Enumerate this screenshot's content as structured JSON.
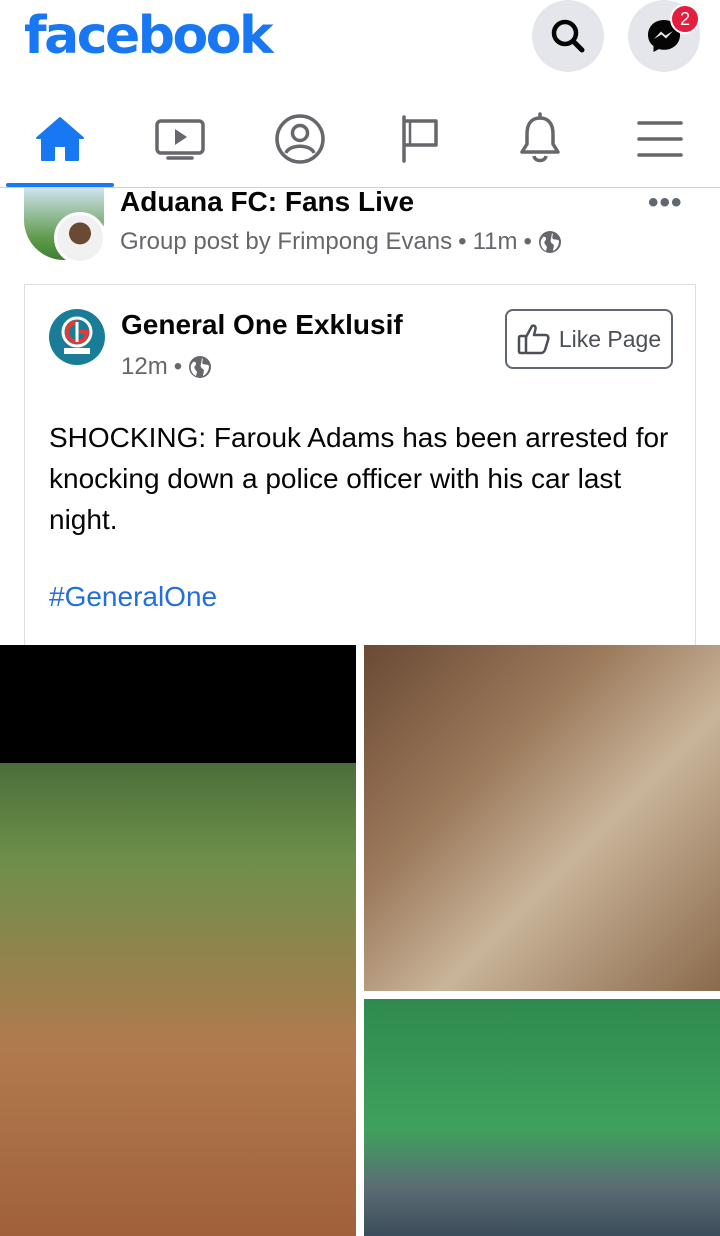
{
  "app": {
    "brand": "facebook",
    "brand_color": "#1877f2",
    "messenger_badge": "2"
  },
  "header": {
    "icons": [
      "search-icon",
      "messenger-icon"
    ]
  },
  "nav": {
    "tabs": [
      {
        "icon": "home-icon",
        "active": true
      },
      {
        "icon": "watch-icon",
        "active": false
      },
      {
        "icon": "profile-icon",
        "active": false
      },
      {
        "icon": "pages-flag-icon",
        "active": false
      },
      {
        "icon": "notifications-bell-icon",
        "active": false
      },
      {
        "icon": "menu-icon",
        "active": false
      }
    ]
  },
  "post": {
    "group_name": "Aduana FC: Fans Live",
    "author_line": "Group post by Frimpong Evans",
    "time": "11m",
    "privacy_icon": "globe-icon",
    "shared": {
      "page_name": "General One Exklusif",
      "time": "12m",
      "like_label": "Like Page",
      "text": "SHOCKING: Farouk Adams has been arrested for knocking down a police officer with his car last night.",
      "hashtag": "#GeneralOne"
    }
  }
}
